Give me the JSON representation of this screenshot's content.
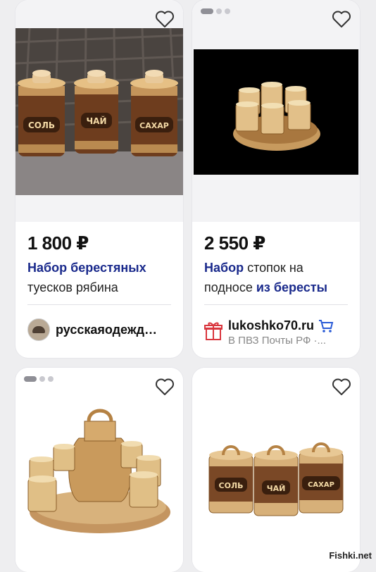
{
  "products": [
    {
      "price": "1 800 ₽",
      "title_bold": "Набор берестяных",
      "title_rest": "туесков рябина",
      "seller": "русскаяодежд…",
      "labels": [
        "СОЛЬ",
        "ЧАЙ",
        "САХАР"
      ]
    },
    {
      "price": "2 550 ₽",
      "title_bold_1": "Набор",
      "title_norm_1": " стопок на",
      "title_norm_2": "подносе ",
      "title_bold_2": "из бересты",
      "seller": "lukoshko70.ru",
      "seller_sub": "В ПВЗ Почты РФ ·..."
    },
    {},
    {
      "labels": [
        "СОЛЬ",
        "ЧАЙ",
        "САХАР"
      ]
    }
  ],
  "watermark": "Fishki.net",
  "icons": {
    "favorite": "heart-icon",
    "cart": "cart-icon",
    "gift": "gift-icon"
  }
}
